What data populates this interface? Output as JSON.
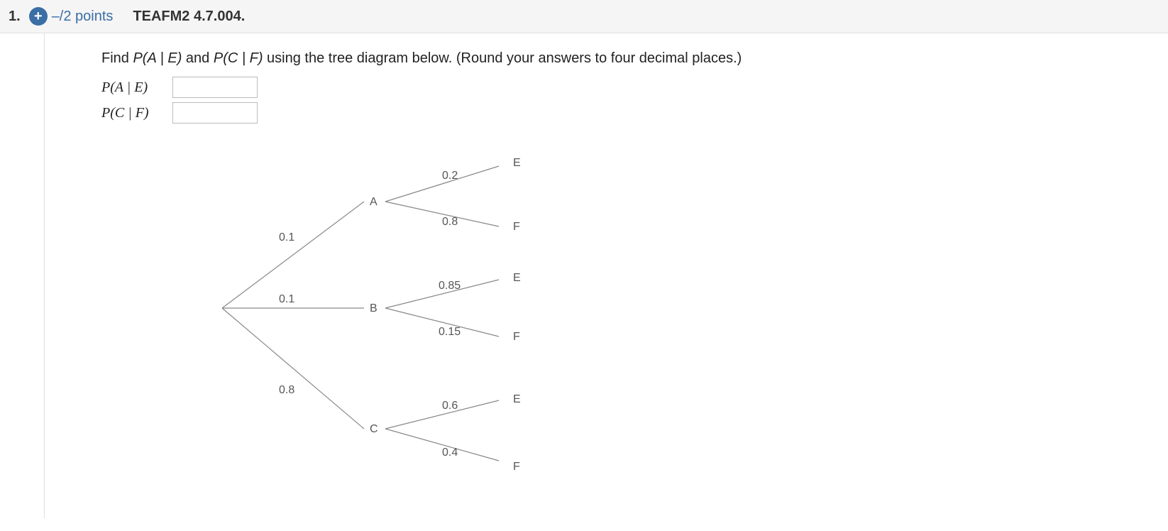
{
  "header": {
    "question_number": "1.",
    "plus": "+",
    "points": "–/2 points",
    "code": "TEAFM2 4.7.004."
  },
  "prompt": {
    "p1": "Find ",
    "expr1": "P(A | E)",
    "p2": " and ",
    "expr2": "P(C | F)",
    "p3": " using the tree diagram below. (Round your answers to four decimal places.)"
  },
  "answers": {
    "label1": "P(A | E)",
    "label2": "P(C | F)"
  },
  "tree": {
    "first": [
      {
        "label": "A",
        "prob": "0.1"
      },
      {
        "label": "B",
        "prob": "0.1"
      },
      {
        "label": "C",
        "prob": "0.8"
      }
    ],
    "second": {
      "A": [
        {
          "label": "E",
          "prob": "0.2"
        },
        {
          "label": "F",
          "prob": "0.8"
        }
      ],
      "B": [
        {
          "label": "E",
          "prob": "0.85"
        },
        {
          "label": "F",
          "prob": "0.15"
        }
      ],
      "C": [
        {
          "label": "E",
          "prob": "0.6"
        },
        {
          "label": "F",
          "prob": "0.4"
        }
      ]
    }
  },
  "chart_data": {
    "type": "tree",
    "levels": [
      {
        "from": "root",
        "branches": [
          {
            "to": "A",
            "p": 0.1
          },
          {
            "to": "B",
            "p": 0.1
          },
          {
            "to": "C",
            "p": 0.8
          }
        ]
      },
      {
        "from": "A",
        "branches": [
          {
            "to": "E",
            "p": 0.2
          },
          {
            "to": "F",
            "p": 0.8
          }
        ]
      },
      {
        "from": "B",
        "branches": [
          {
            "to": "E",
            "p": 0.85
          },
          {
            "to": "F",
            "p": 0.15
          }
        ]
      },
      {
        "from": "C",
        "branches": [
          {
            "to": "E",
            "p": 0.6
          },
          {
            "to": "F",
            "p": 0.4
          }
        ]
      }
    ]
  }
}
